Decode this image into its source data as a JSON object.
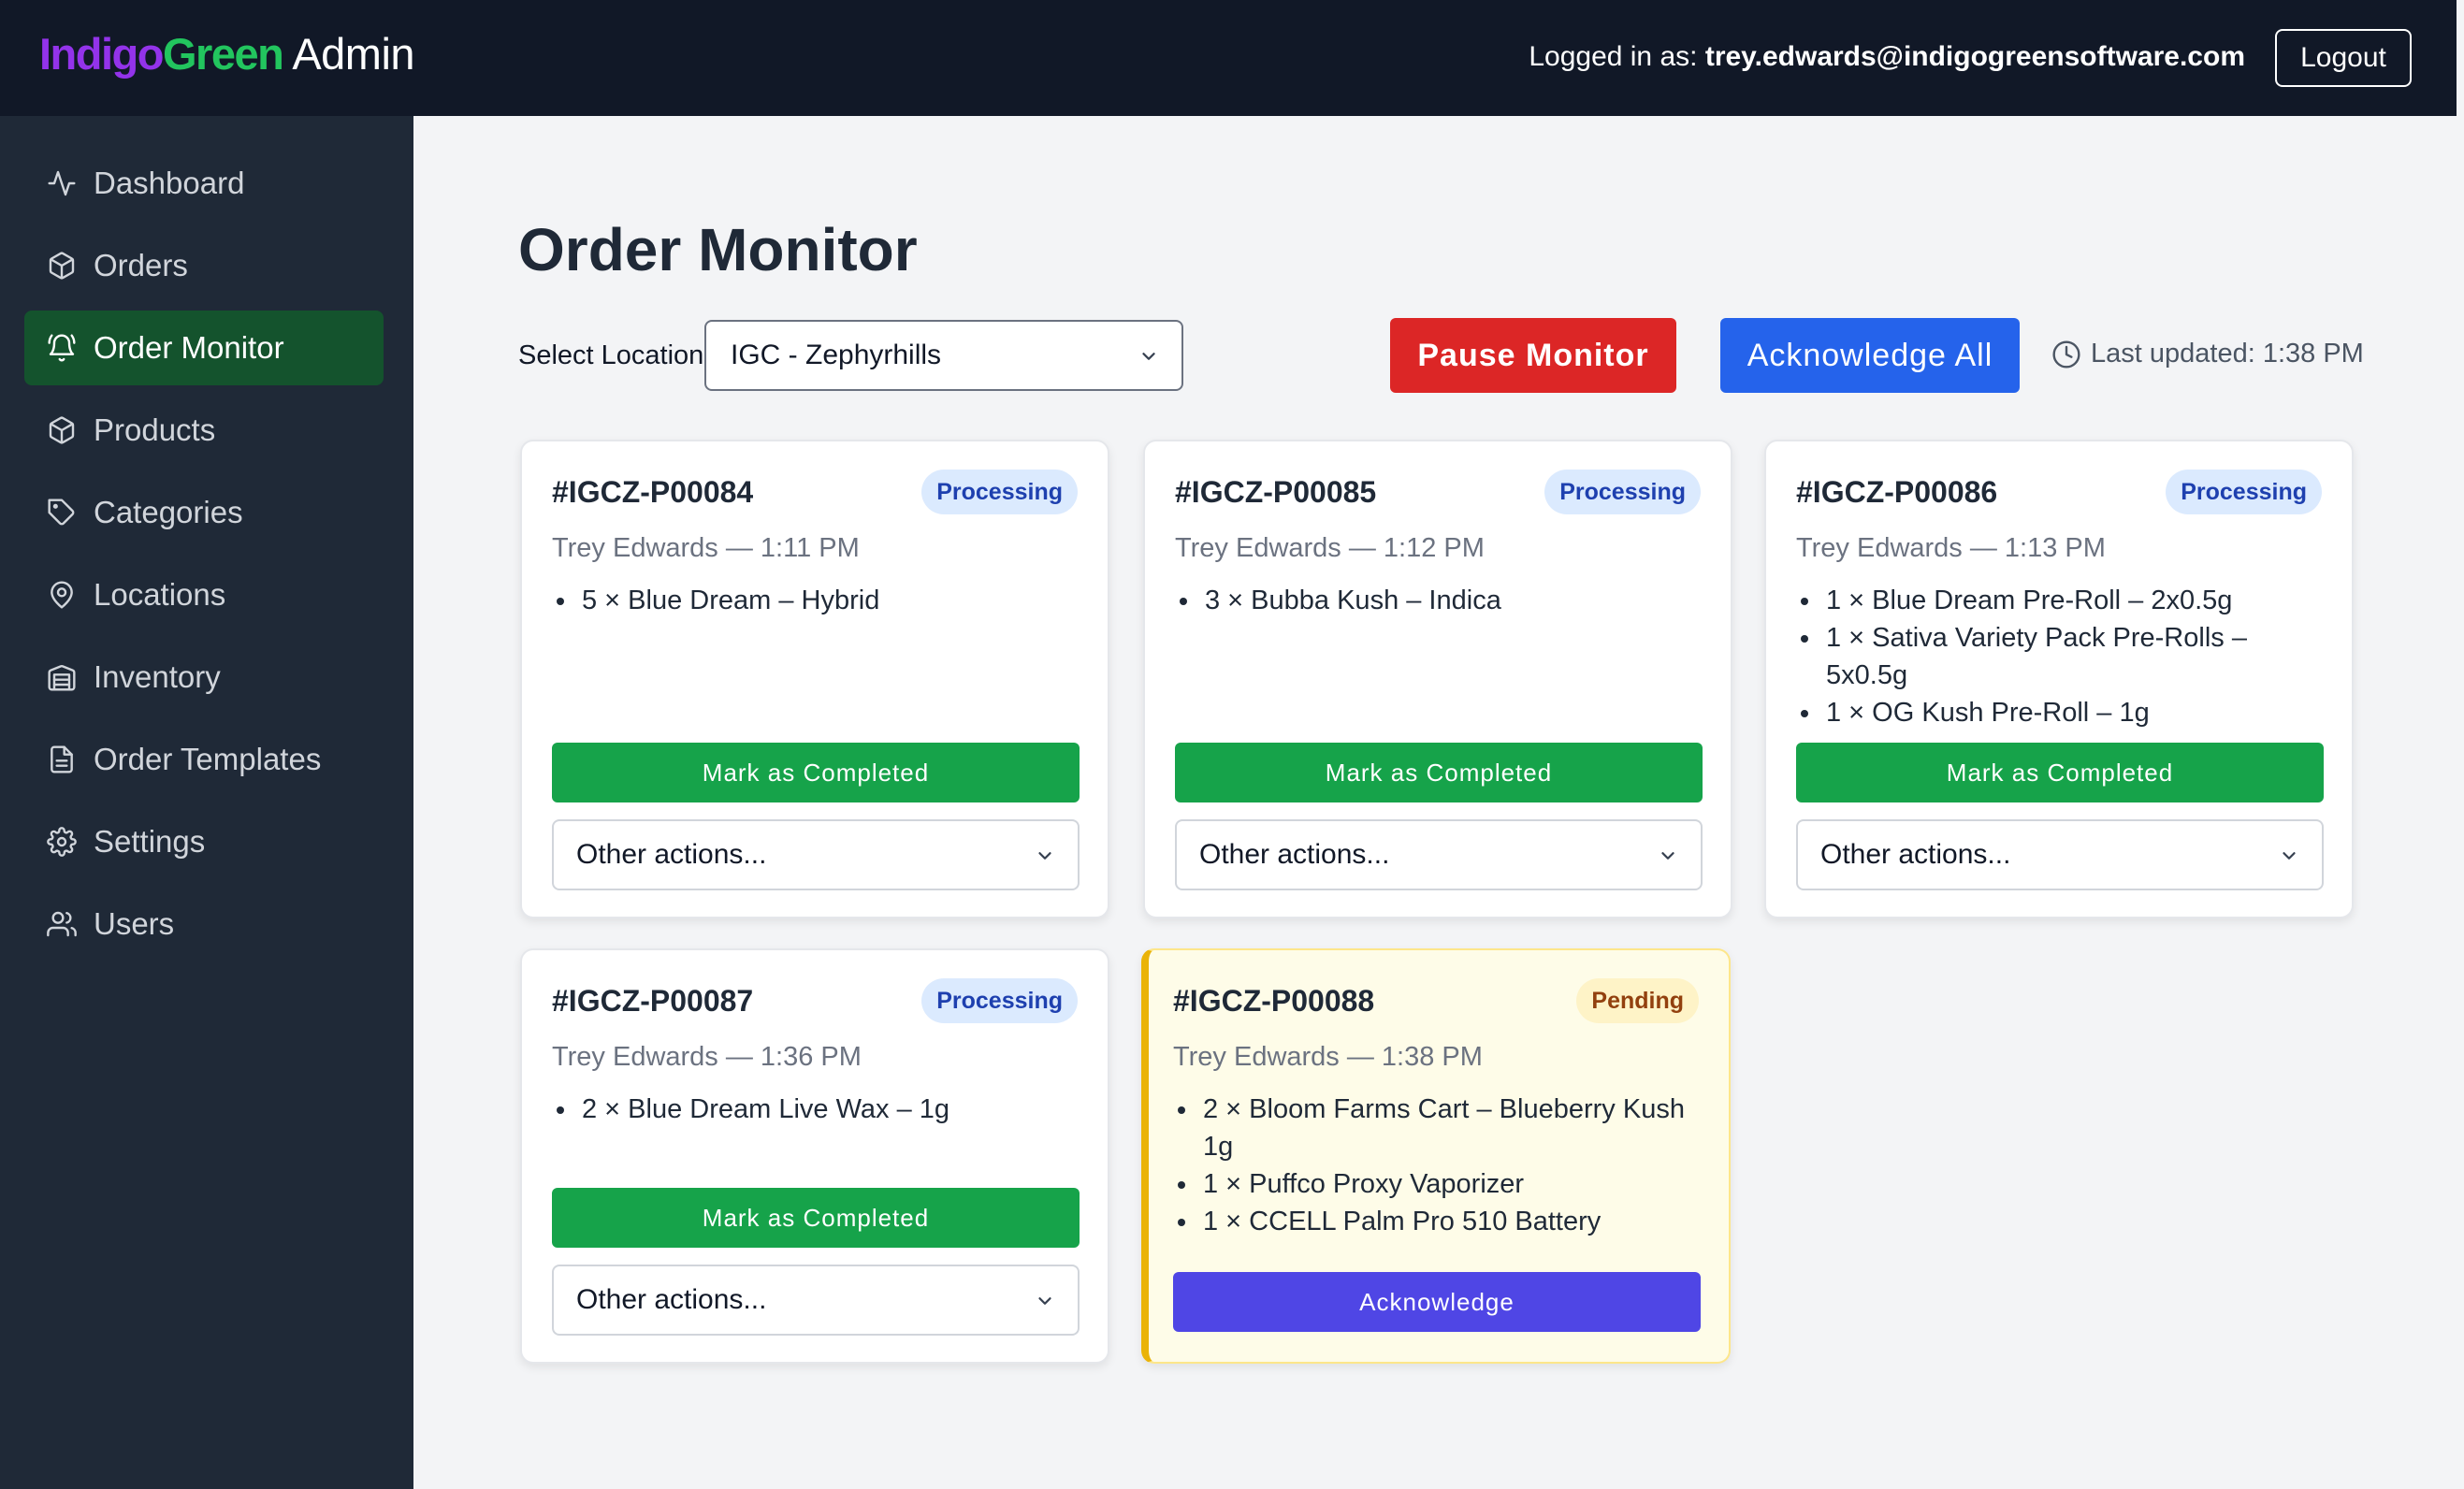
{
  "brand": {
    "part1": "Indigo",
    "part2": "Green",
    "suffix": "Admin",
    "color1": "#9333ea",
    "color2": "#22c55e"
  },
  "header": {
    "login_prefix": "Logged in as:",
    "user_email": "trey.edwards@indigogreensoftware.com",
    "logout_label": "Logout"
  },
  "sidebar": {
    "items": [
      {
        "label": "Dashboard",
        "icon": "activity-icon"
      },
      {
        "label": "Orders",
        "icon": "package-icon"
      },
      {
        "label": "Order Monitor",
        "icon": "bell-icon",
        "active": true
      },
      {
        "label": "Products",
        "icon": "package-icon"
      },
      {
        "label": "Categories",
        "icon": "tag-icon"
      },
      {
        "label": "Locations",
        "icon": "map-pin-icon"
      },
      {
        "label": "Inventory",
        "icon": "archive-icon"
      },
      {
        "label": "Order Templates",
        "icon": "file-text-icon"
      },
      {
        "label": "Settings",
        "icon": "gear-icon"
      },
      {
        "label": "Users",
        "icon": "users-icon"
      }
    ]
  },
  "main": {
    "title": "Order Monitor",
    "location_label": "Select Location:",
    "location_value": "IGC - Zephyrhills",
    "pause_label": "Pause Monitor",
    "ack_all_label": "Acknowledge All",
    "last_updated": "Last updated: 1:38 PM"
  },
  "orders": [
    {
      "id": "#IGCZ-P00084",
      "status": "Processing",
      "customer_time": "Trey Edwards — 1:11 PM",
      "items": [
        "5 × Blue Dream – Hybrid"
      ],
      "complete_label": "Mark as Completed",
      "actions_label": "Other actions..."
    },
    {
      "id": "#IGCZ-P00085",
      "status": "Processing",
      "customer_time": "Trey Edwards — 1:12 PM",
      "items": [
        "3 × Bubba Kush – Indica"
      ],
      "complete_label": "Mark as Completed",
      "actions_label": "Other actions..."
    },
    {
      "id": "#IGCZ-P00086",
      "status": "Processing",
      "customer_time": "Trey Edwards — 1:13 PM",
      "items": [
        "1 × Blue Dream Pre-Roll – 2x0.5g",
        "1 × Sativa Variety Pack Pre-Rolls – 5x0.5g",
        "1 × OG Kush Pre-Roll – 1g"
      ],
      "complete_label": "Mark as Completed",
      "actions_label": "Other actions..."
    },
    {
      "id": "#IGCZ-P00087",
      "status": "Processing",
      "customer_time": "Trey Edwards — 1:36 PM",
      "items": [
        "2 × Blue Dream Live Wax – 1g"
      ],
      "complete_label": "Mark as Completed",
      "actions_label": "Other actions..."
    },
    {
      "id": "#IGCZ-P00088",
      "status": "Pending",
      "customer_time": "Trey Edwards — 1:38 PM",
      "items": [
        "2 × Bloom Farms Cart – Blueberry Kush 1g",
        "1 × Puffco Proxy Vaporizer",
        "1 × CCELL Palm Pro 510 Battery"
      ],
      "ack_label": "Acknowledge"
    }
  ]
}
